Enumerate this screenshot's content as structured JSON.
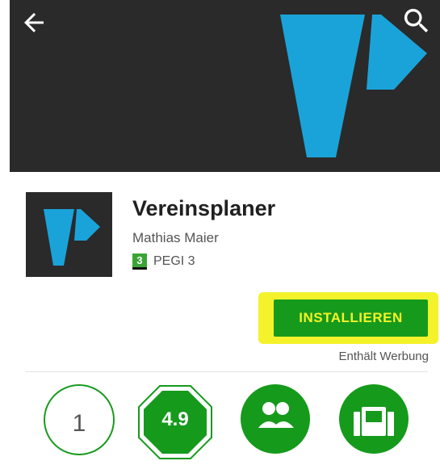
{
  "header": {
    "back_icon": "arrow-left-icon",
    "search_icon": "search-icon",
    "background": "#2a2a2a",
    "logo_color": "#1aa3d9"
  },
  "app": {
    "title": "Vereinsplaner",
    "developer": "Mathias Maier",
    "pegi_badge": "3",
    "pegi_label": "PEGI 3"
  },
  "install": {
    "label": "INSTALLIEREN",
    "button_color": "#169a1c",
    "highlight_color": "#f4f22a"
  },
  "ads_note": "Enthält Werbung",
  "stats": {
    "downloads": "1",
    "rating": "4.9",
    "family_icon": "people-icon",
    "similar_icon": "similar-apps-icon"
  }
}
